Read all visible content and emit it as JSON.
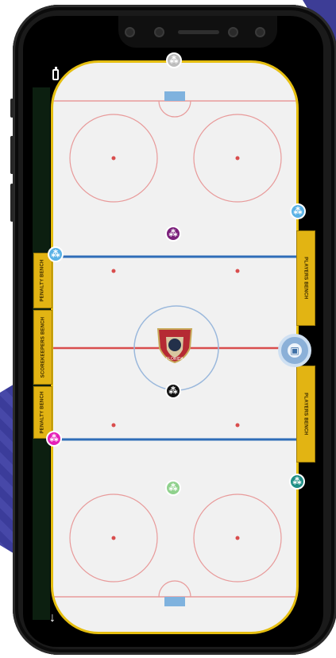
{
  "benches": {
    "left_top": "PENALTY BENCH",
    "left_mid": "SCOREKEEPERS BENCH",
    "left_bottom": "PENALTY BENCH",
    "right_top": "PLAYERS BENCH",
    "right_bottom": "PLAYERS BENCH"
  },
  "logo": {
    "text": "FLORIDA"
  },
  "colors": {
    "rink_border": "#e5be10",
    "blue_line": "#2f6db8",
    "red_line": "#d94d4d",
    "token_top": "#bdbdbd",
    "token_purple": "#7b1f7b",
    "token_black": "#111111",
    "token_light_green": "#8fd18c",
    "token_light_blue": "#5ab2e6",
    "token_magenta": "#e51fb8",
    "token_teal": "#1f8f86"
  },
  "icons": {
    "player_token": "people-icon",
    "center": "camera-icon",
    "battery": "battery-icon",
    "down": "down-arrow-icon"
  }
}
